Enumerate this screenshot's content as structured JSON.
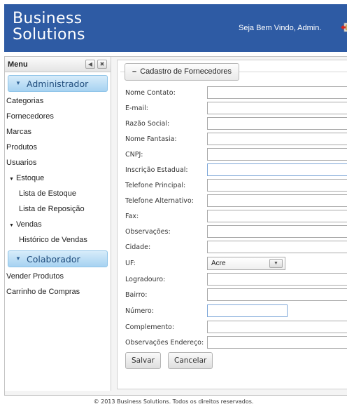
{
  "header": {
    "brand_line1": "Business",
    "brand_line2": "Solutions",
    "welcome": "Seja Bem Vindo, Admin.",
    "logout_icon": "logout-icon"
  },
  "sidebar": {
    "title": "Menu",
    "collapse_icon": "collapse-left-icon",
    "close_icon": "close-icon",
    "groups": [
      {
        "label": "Administrador",
        "items": [
          "Categorias",
          "Fornecedores",
          "Marcas",
          "Produtos",
          "Usuarios"
        ],
        "estoque": {
          "label": "Estoque",
          "items": [
            "Lista de Estoque",
            "Lista de Reposição"
          ]
        },
        "vendas": {
          "label": "Vendas",
          "items": [
            "Histórico de Vendas"
          ]
        }
      },
      {
        "label": "Colaborador",
        "items": [
          "Vender Produtos",
          "Carrinho de Compras"
        ]
      }
    ]
  },
  "form": {
    "legend": "Cadastro de Fornecedores",
    "legend_prefix": "–",
    "fields": [
      {
        "label": "Nome Contato:",
        "value": ""
      },
      {
        "label": "E-mail:",
        "value": ""
      },
      {
        "label": "Razão Social:",
        "value": ""
      },
      {
        "label": "Nome Fantasia:",
        "value": ""
      },
      {
        "label": "CNPJ:",
        "value": ""
      },
      {
        "label": "Inscrição Estadual:",
        "value": ""
      },
      {
        "label": "Telefone Principal:",
        "value": ""
      },
      {
        "label": "Telefone Alternativo:",
        "value": ""
      },
      {
        "label": "Fax:",
        "value": ""
      },
      {
        "label": "Observações:",
        "value": ""
      },
      {
        "label": "Cidade:",
        "value": ""
      },
      {
        "label": "UF:",
        "value": "Acre"
      },
      {
        "label": "Logradouro:",
        "value": ""
      },
      {
        "label": "Bairro:",
        "value": ""
      },
      {
        "label": "Número:",
        "value": ""
      },
      {
        "label": "Complemento:",
        "value": ""
      },
      {
        "label": "Observações Endereço:",
        "value": ""
      }
    ],
    "save_label": "Salvar",
    "cancel_label": "Cancelar"
  },
  "footer": {
    "text": "© 2013 Business Solutions. Todos os direitos reservados."
  }
}
